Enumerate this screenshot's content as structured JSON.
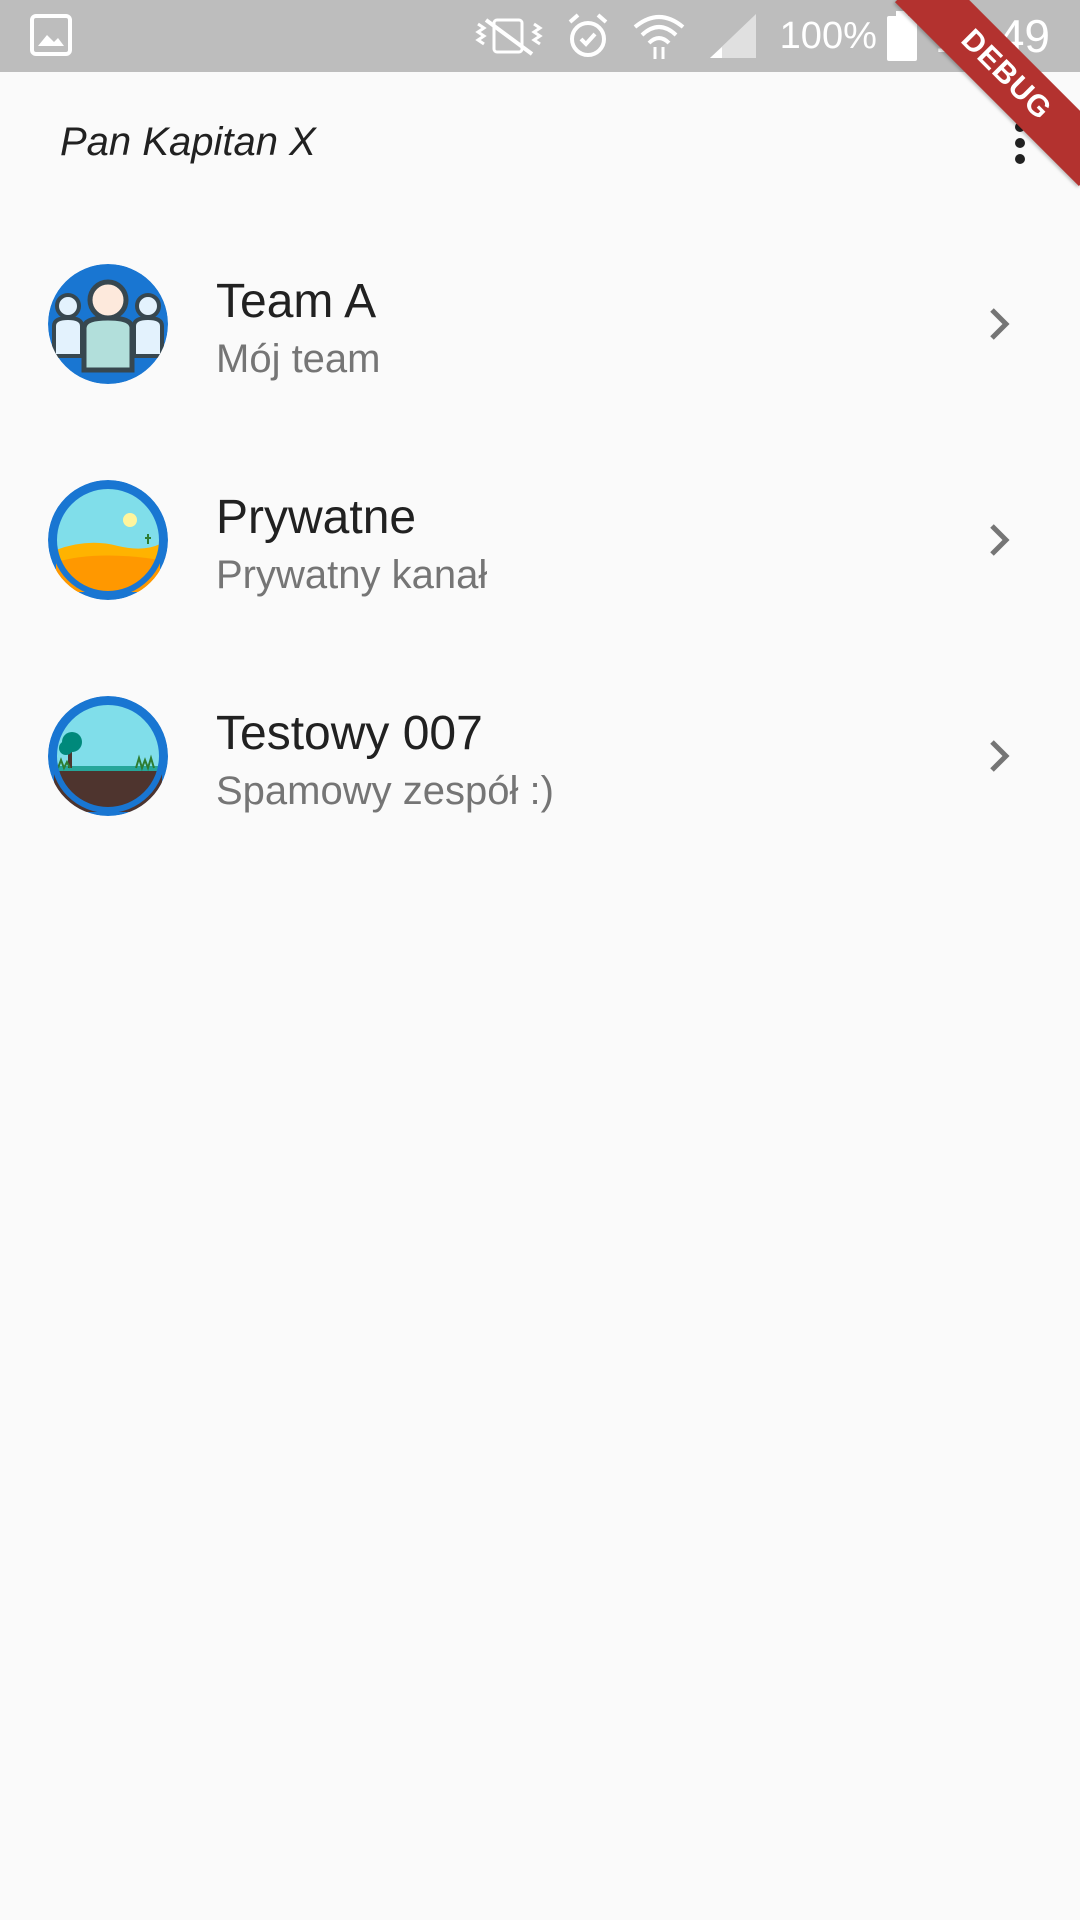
{
  "status_bar": {
    "battery_percent": "100%",
    "time": "18:49",
    "icons": [
      "gallery-icon",
      "mute-vibrate-icon",
      "alarm-icon",
      "wifi-icon",
      "signal-icon",
      "battery-icon"
    ]
  },
  "debug_banner": "DEBUG",
  "app_bar": {
    "title": "Pan Kapitan X",
    "menu_icon": "more-vert-icon"
  },
  "teams": [
    {
      "title": "Team A",
      "subtitle": "Mój team",
      "avatar": "people-avatar"
    },
    {
      "title": "Prywatne",
      "subtitle": "Prywatny kanał",
      "avatar": "desert-avatar"
    },
    {
      "title": "Testowy 007",
      "subtitle": "Spamowy zespół :)",
      "avatar": "landscape-avatar"
    }
  ],
  "colors": {
    "avatar_ring": "#1976d2",
    "status_bar": "#bdbdbd",
    "debug_ribbon": "#b3322f",
    "background": "#fafafa"
  }
}
